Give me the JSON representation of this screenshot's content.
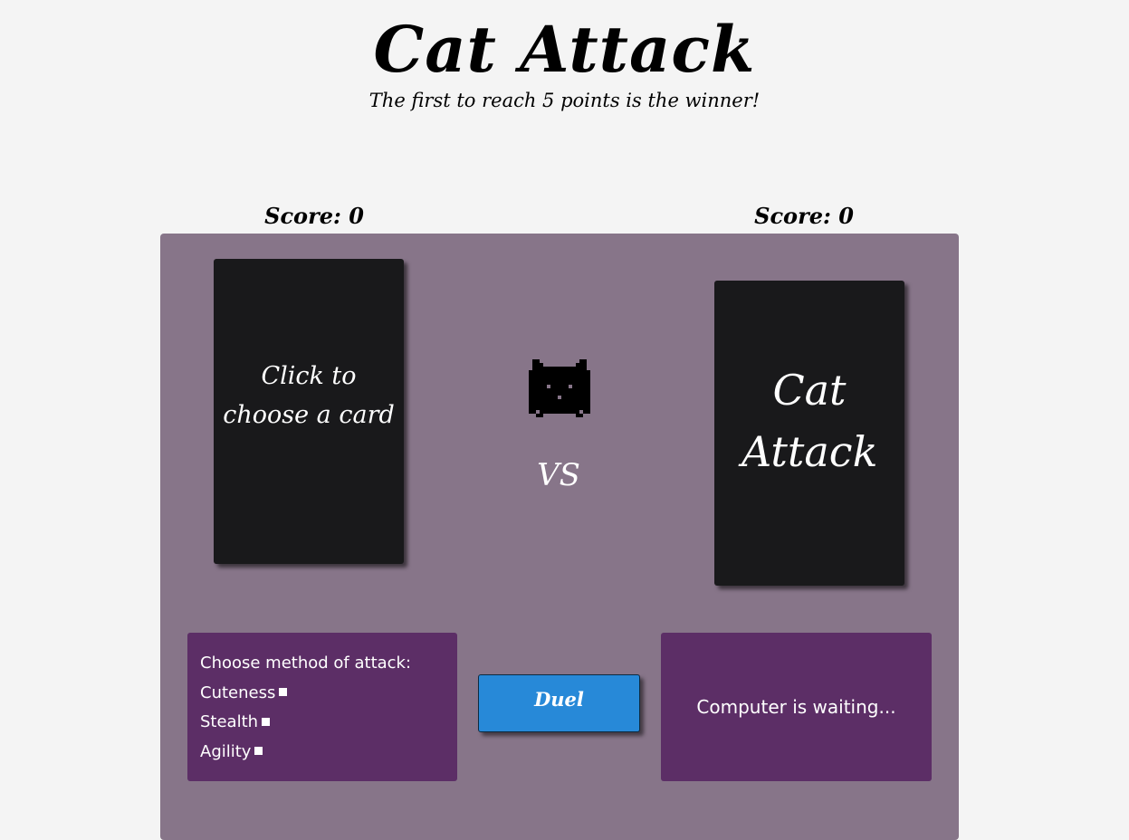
{
  "header": {
    "title": "Cat Attack",
    "subtitle": "The first to reach 5 points is the winner!"
  },
  "scores": {
    "player_label": "Score: 0",
    "computer_label": "Score: 0",
    "player_value": 0,
    "computer_value": 0
  },
  "board": {
    "player_card_text": "Click to choose a card",
    "computer_card_text": "Cat Attack",
    "vs_label": "VS",
    "center_icon": "pixel-cat-icon"
  },
  "attack_panel": {
    "heading": "Choose method of attack:",
    "options": [
      {
        "label": "Cuteness"
      },
      {
        "label": "Stealth"
      },
      {
        "label": "Agility"
      }
    ]
  },
  "duel_button": {
    "label": "Duel"
  },
  "status_panel": {
    "text": "Computer is waiting..."
  },
  "colors": {
    "page_background": "#f4f4f4",
    "board_background": "#877589",
    "card_background": "#19191b",
    "panel_background": "#5c2e66",
    "button_background": "#2789d8"
  }
}
